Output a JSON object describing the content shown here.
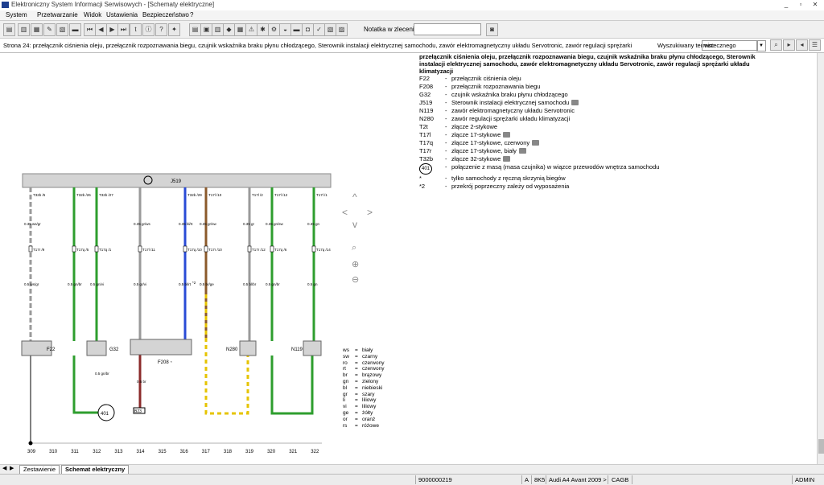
{
  "window": {
    "title": "Elektroniczny System Informacji Serwisowych - [Schematy elektryczne]",
    "min": "_",
    "max": "▫",
    "close": "✕"
  },
  "menu": [
    "System",
    "Przetwarzanie",
    "Widok",
    "Ustawienia",
    "Bezpieczeństwo",
    "?"
  ],
  "toolbar": {
    "notatka_label": "Notatka w zleceniu:",
    "notatka_value": ""
  },
  "search": {
    "page_title": "Strona 24: przełącznik ciśnienia oleju, przełącznik rozpoznawania biegu, czujnik wskaźnika braku płynu chłodzącego, Sterownik instalacji elektrycznej samochodu, zawór elektromagnetyczny układu Servotronic, zawór regulacji sprężarki",
    "label": "Wyszukiwany termin:",
    "value": "wstecznego"
  },
  "legend": {
    "heading": [
      "przełącznik ciśnienia oleju, przełącznik rozpoznawania biegu, czujnik wskaźnika braku płynu chłodzącego, Sterownik",
      "instalacji elektrycznej samochodu, zawór elektromagnetyczny układu Servotronic, zawór regulacji sprężarki układu",
      "klimatyzacji"
    ],
    "items": [
      {
        "code": "F22",
        "desc": "przełącznik ciśnienia oleju",
        "cam": false
      },
      {
        "code": "F208",
        "desc": "przełącznik rozpoznawania biegu",
        "cam": false
      },
      {
        "code": "G32",
        "desc": "czujnik wskaźnika braku płynu chłodzącego",
        "cam": false
      },
      {
        "code": "J519",
        "desc": "Sterownik instalacji elektrycznej samochodu",
        "cam": true
      },
      {
        "code": "N119",
        "desc": "zawór elektromagnetyczny układu Servotronic",
        "cam": false
      },
      {
        "code": "N280",
        "desc": "zawór regulacji sprężarki układu klimatyzacji",
        "cam": false
      },
      {
        "code": "T2t",
        "desc": "złącze 2-stykowe",
        "cam": false
      },
      {
        "code": "T17l",
        "desc": "złącze 17-stykowe",
        "cam": true
      },
      {
        "code": "T17q",
        "desc": "złącze 17-stykowe, czerwony",
        "cam": true
      },
      {
        "code": "T17r",
        "desc": "złącze 17-stykowe, biały",
        "cam": true
      },
      {
        "code": "T32b",
        "desc": "złącze 32-stykowe",
        "cam": true
      },
      {
        "code": "401",
        "desc": "połączenie z masą (masa czujnika) w wiązce przewodów wnętrza samochodu",
        "cam": false
      },
      {
        "code": "*",
        "desc": "tylko samochody z ręczną skrzynią biegów",
        "cam": false
      },
      {
        "code": "*2",
        "desc": "przekrój poprzeczny zależy od wyposażenia",
        "cam": false
      }
    ]
  },
  "diagram": {
    "control_unit": "J519",
    "current_paths": [
      "309",
      "310",
      "311",
      "312",
      "313",
      "314",
      "315",
      "316",
      "317",
      "318",
      "319",
      "320",
      "321",
      "322"
    ],
    "components": {
      "f22": "F22",
      "g32": "G32",
      "f208": "F208",
      "n280": "N280",
      "n119": "N119",
      "ground": "401",
      "ref": "B23"
    },
    "wires": [
      {
        "pin_top": "T32b /5",
        "spec_top": "0.35 ws/gr",
        "conn": "T17r /9",
        "spec_bot": "0.5 ws/gr",
        "color": "#9a9a9a"
      },
      {
        "pin_top": "T32b /26",
        "spec_top": "",
        "conn": "T17q /5",
        "spec_bot": "0.5 gn/br",
        "color": "#2e9e2e"
      },
      {
        "pin_top": "T32b /27",
        "spec_top": "",
        "conn": "T17q /1",
        "spec_bot": "0.5 gn/vi",
        "color": "#2e9e2e"
      },
      {
        "pin_top": "",
        "spec_top": "0.35 gr/ws",
        "conn": "T17l /11",
        "spec_bot": "0.5 gr/vi",
        "color": "#9a9a9a"
      },
      {
        "pin_top": "T32b /29",
        "spec_top": "0.35 bl/rt",
        "conn": "T17q /10",
        "spec_bot": "0.5 bl/rt",
        "color": "#2a4bd6"
      },
      {
        "pin_top": "T17l /10",
        "spec_top": "0.35 gr/sw",
        "conn": "T17r /10",
        "spec_bot": "0.5 br/ge",
        "color": "#8b5a2b"
      },
      {
        "pin_top": "T17l /2",
        "spec_top": "0.35 gr",
        "conn": "T17r /12",
        "spec_bot": "0.5 bl/br",
        "color": "#9a9a9a"
      },
      {
        "pin_top": "T17l /12",
        "spec_top": "0.35 gn/sw",
        "conn": "T17q /6",
        "spec_bot": "0.5 gn/br",
        "color": "#2e9e2e"
      },
      {
        "pin_top": "T17l /1",
        "spec_top": "0.35 gn",
        "conn": "T17q /14",
        "spec_bot": "0.5 gn",
        "color": "#2e9e2e"
      }
    ],
    "ground_wire": {
      "spec": "0.5 br",
      "second": "0.5 gn/br"
    },
    "notes": [
      "*",
      "*2"
    ]
  },
  "color_codes": [
    {
      "k": "ws",
      "v": "biały"
    },
    {
      "k": "sw",
      "v": "czarny"
    },
    {
      "k": "ro",
      "v": "czerwony"
    },
    {
      "k": "rt",
      "v": "czerwony"
    },
    {
      "k": "br",
      "v": "brązowy"
    },
    {
      "k": "gn",
      "v": "zielony"
    },
    {
      "k": "bl",
      "v": "niebieski"
    },
    {
      "k": "gr",
      "v": "szary"
    },
    {
      "k": "li",
      "v": "liliowy"
    },
    {
      "k": "vi",
      "v": "liliowy"
    },
    {
      "k": "ge",
      "v": "żółty"
    },
    {
      "k": "or",
      "v": "oranż"
    },
    {
      "k": "rs",
      "v": "różowe"
    }
  ],
  "tabs": [
    "Zestawienie",
    "Schemat elektryczny"
  ],
  "status": {
    "code": "9000000219",
    "a": "A",
    "model_code": "8K5",
    "model": "Audi A4 Avant 2009 >",
    "engine": "CAGB",
    "user": "ADMIN"
  }
}
